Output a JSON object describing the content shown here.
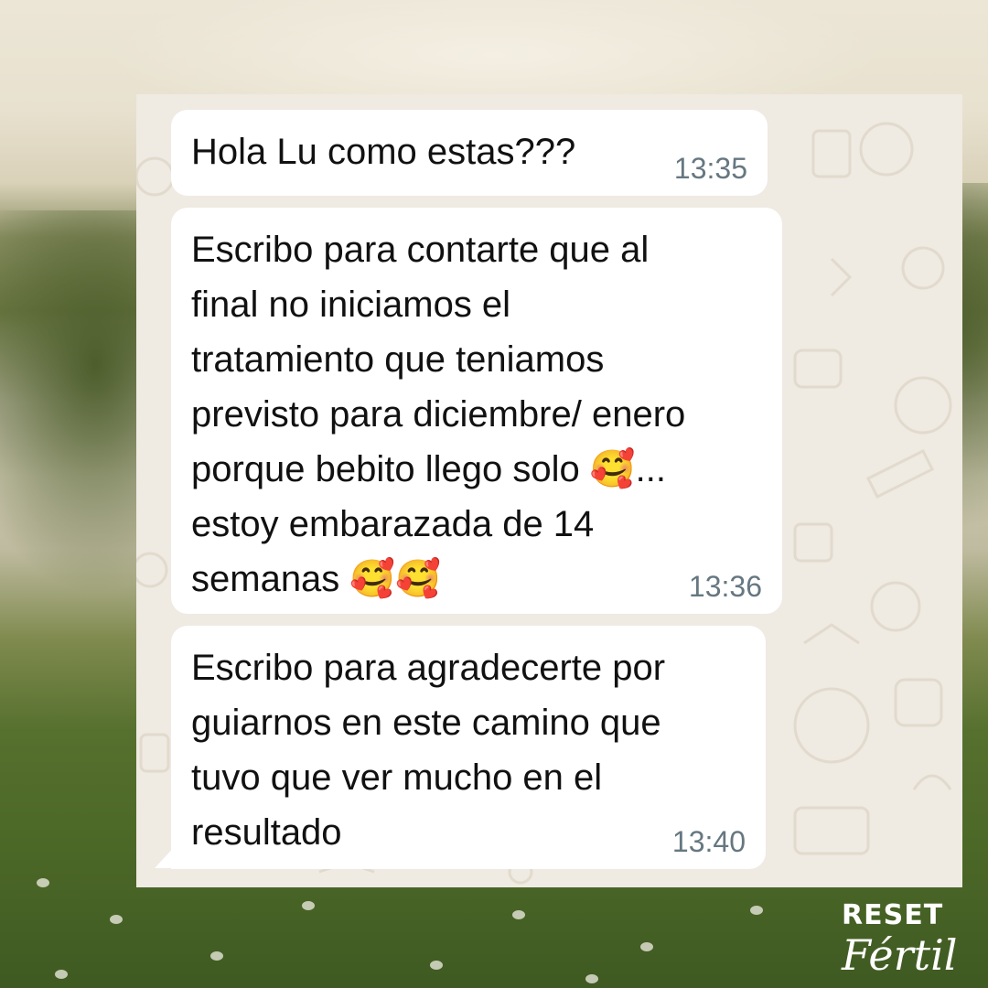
{
  "messages": [
    {
      "text": "Hola Lu como estas???",
      "time": "13:35"
    },
    {
      "text": "Escribo para contarte que al\nfinal no iniciamos el\ntratamiento que teniamos\nprevisto para diciembre/ enero\nporque bebito llego solo 🥰...\nestoy embarazada de 14\nsemanas 🥰🥰",
      "time": "13:36"
    },
    {
      "text": "Escribo para agradecerte por\nguiarnos en este camino que\ntuvo que ver mucho en el\nresultado",
      "time": "13:40"
    }
  ],
  "logo": {
    "line1": "RESET",
    "line2": "Fértil"
  },
  "colors": {
    "chat_background": "#efeae2",
    "bubble": "#ffffff",
    "timestamp": "#667781"
  }
}
